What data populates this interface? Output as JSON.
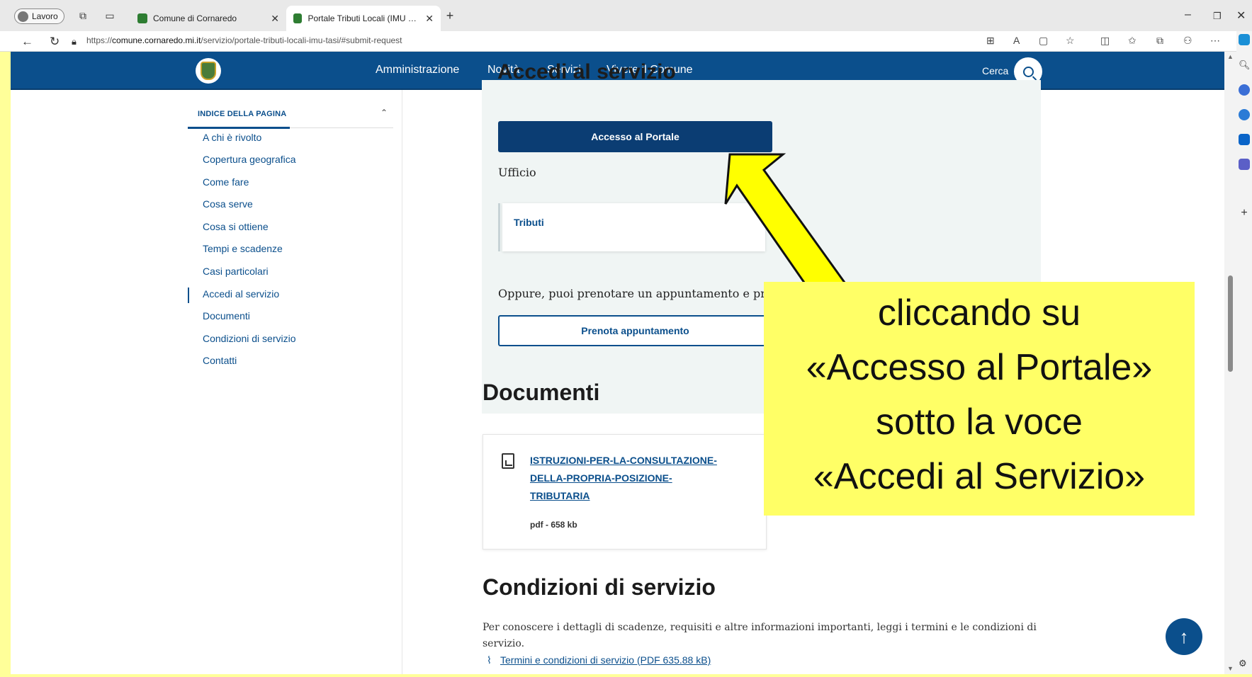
{
  "browser": {
    "profile_label": "Lavoro",
    "tabs": [
      {
        "title": "Comune di Cornaredo",
        "active": false
      },
      {
        "title": "Portale Tributi Locali (IMU e TARI",
        "active": true
      }
    ],
    "url_prefix": "https://",
    "url_domain": "comune.cornaredo.mi.it",
    "url_path": "/servizio/portale-tributi-locali-imu-tasi/#submit-request"
  },
  "header": {
    "nav": [
      "Amministrazione",
      "Novità",
      "Servizi",
      "Vivere il Comune"
    ],
    "search_label": "Cerca"
  },
  "index": {
    "title": "INDICE DELLA PAGINA",
    "items": [
      "A chi è rivolto",
      "Copertura geografica",
      "Come fare",
      "Cosa serve",
      "Cosa si ottiene",
      "Tempi e scadenze",
      "Casi particolari",
      "Accedi al servizio",
      "Documenti",
      "Condizioni di servizio",
      "Contatti"
    ],
    "active_item": "Accedi al servizio"
  },
  "access_section": {
    "heading": "Accedi al servizio",
    "portal_button": "Accesso al Portale",
    "office_label": "Ufficio",
    "office_name": "Tributi",
    "appointment_text": "Oppure, puoi prenotare un appuntamento e pres",
    "appointment_button": "Prenota appuntamento"
  },
  "documents_section": {
    "heading": "Documenti",
    "document_lines": [
      "ISTRUZIONI-PER-LA-CONSULTAZIONE-",
      "DELLA-PROPRIA-POSIZIONE-",
      "TRIBUTARIA"
    ],
    "document_meta": "pdf - 658 kb"
  },
  "conditions_section": {
    "heading": "Condizioni di servizio",
    "text_line1": "Per conoscere i dettagli di scadenze, requisiti e altre informazioni importanti, leggi i termini e le condizioni di",
    "text_line2": "servizio.",
    "link": "Termini e condizioni di servizio (PDF 635.88 kB)"
  },
  "annotation": {
    "lines": [
      "cliccando su",
      "«Accesso al Portale»",
      "sotto la voce",
      "«Accedi al Servizio»"
    ],
    "color": "#ffff66"
  },
  "colors": {
    "brand": "#0b4f8c",
    "highlight": "#ffff99"
  }
}
